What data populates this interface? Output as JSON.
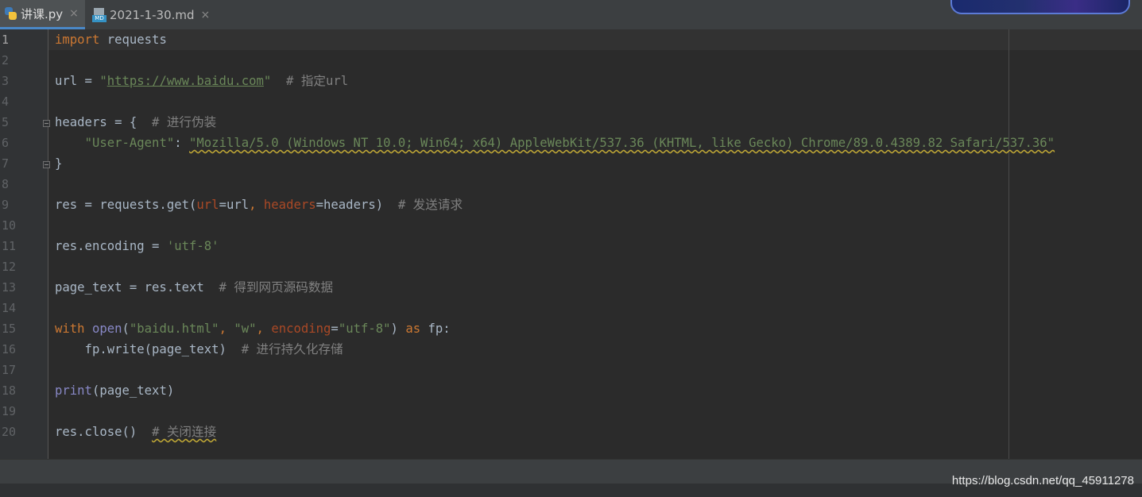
{
  "tabs": [
    {
      "label": "讲课.py",
      "icon": "python-file-icon",
      "active": true
    },
    {
      "label": "2021-1-30.md",
      "icon": "markdown-file-icon",
      "active": false
    }
  ],
  "tab_close_glyph": "×",
  "md_icon_text": "MD",
  "line_numbers": [
    "1",
    "2",
    "3",
    "4",
    "5",
    "6",
    "7",
    "8",
    "9",
    "10",
    "11",
    "12",
    "13",
    "14",
    "15",
    "16",
    "17",
    "18",
    "19",
    "20"
  ],
  "code": {
    "l1": {
      "kw_import": "import",
      "rest": " requests"
    },
    "l3": {
      "pre": "url = ",
      "q1": "\"",
      "url": "https://www.baidu.com",
      "q2": "\"",
      "comment": "  # 指定url"
    },
    "l5": {
      "pre": "headers = {",
      "comment": "  # 进行伪装"
    },
    "l6": {
      "indent": "    ",
      "key": "\"User-Agent\"",
      "colon": ": ",
      "value": "\"Mozilla/5.0 (Windows NT 10.0; Win64; x64) AppleWebKit/537.36 (KHTML, like Gecko) Chrome/89.0.4389.82 Safari/537.36\""
    },
    "l7": {
      "text": "}"
    },
    "l9": {
      "pre": "res = requests.get(",
      "p1": "url",
      "eq1": "=url",
      "comma": ", ",
      "p2": "headers",
      "eq2": "=headers)",
      "comment": "  # 发送请求"
    },
    "l11": {
      "pre": "res.encoding = ",
      "str": "'utf-8'"
    },
    "l13": {
      "pre": "page_text = res.text",
      "comment": "  # 得到网页源码数据"
    },
    "l15": {
      "kw_with": "with",
      "sp1": " ",
      "open": "open",
      "paren": "(",
      "s1": "\"baidu.html\"",
      "c1": ", ",
      "s2": "\"w\"",
      "c2": ", ",
      "p": "encoding",
      "eq": "=",
      "s3": "\"utf-8\"",
      "close": ") ",
      "kw_as": "as",
      "rest": " fp:"
    },
    "l16": {
      "pre": "    fp.write(page_text)",
      "comment": "  # 进行持久化存储"
    },
    "l18": {
      "print": "print",
      "rest": "(page_text)"
    },
    "l20": {
      "pre": "res.close()",
      "gap": "  ",
      "comment": "# 关闭连接"
    }
  },
  "watermark": "https://blog.csdn.net/qq_45911278",
  "colors": {
    "keyword": "#cc7832",
    "string": "#6a8759",
    "comment": "#808080",
    "param": "#aa4926",
    "builtin": "#8888c6",
    "text": "#a9b7c6",
    "background": "#2b2b2b"
  }
}
